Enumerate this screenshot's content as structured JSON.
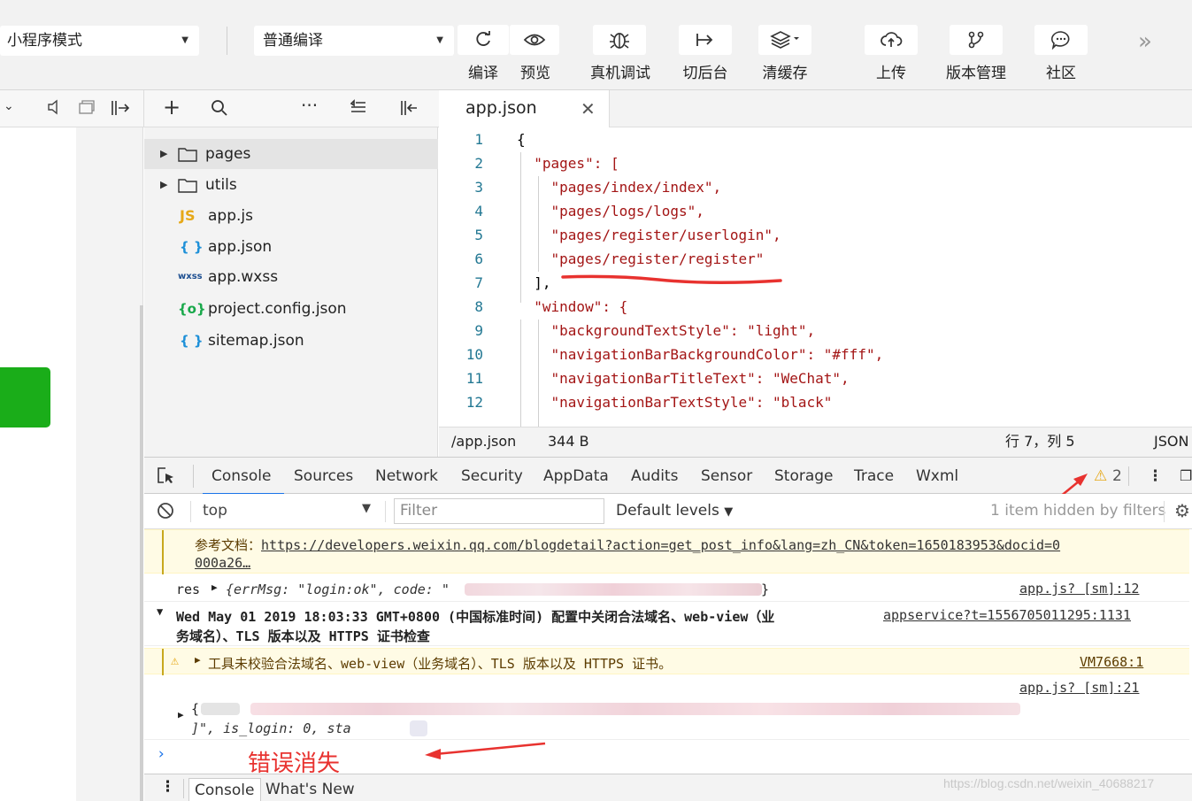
{
  "toolbar": {
    "mode_select": "小程序模式",
    "compile_select": "普通编译",
    "buttons": {
      "compile": "编译",
      "preview": "预览",
      "debug": "真机调试",
      "background": "切后台",
      "clear_cache": "清缓存",
      "upload": "上传",
      "version": "版本管理",
      "community": "社区"
    }
  },
  "file_tree": {
    "items": [
      {
        "name": "pages",
        "icon": "folder-icon"
      },
      {
        "name": "utils",
        "icon": "folder-icon"
      },
      {
        "name": "app.js",
        "icon": "JS"
      },
      {
        "name": "app.json",
        "icon": "{ }"
      },
      {
        "name": "app.wxss",
        "icon": "wxss"
      },
      {
        "name": "project.config.json",
        "icon": "{o}"
      },
      {
        "name": "sitemap.json",
        "icon": "{ }"
      }
    ]
  },
  "editor": {
    "tab_name": "app.json",
    "line_numbers": [
      "1",
      "2",
      "3",
      "4",
      "5",
      "6",
      "7",
      "8",
      "9",
      "10",
      "11",
      "12"
    ],
    "lines": [
      "{",
      "  \"pages\": [",
      "    \"pages/index/index\",",
      "    \"pages/logs/logs\",",
      "    \"pages/register/userlogin\",",
      "    \"pages/register/register\"",
      "  ],",
      "  \"window\": {",
      "    \"backgroundTextStyle\": \"light\",",
      "    \"navigationBarBackgroundColor\": \"#fff\",",
      "    \"navigationBarTitleText\": \"WeChat\",",
      "    \"navigationBarTextStyle\": \"black\""
    ]
  },
  "statusbar": {
    "path": "/app.json",
    "size": "344 B",
    "position": "行 7，列 5",
    "language": "JSON"
  },
  "devtools": {
    "tabs": [
      "Console",
      "Sources",
      "Network",
      "Security",
      "AppData",
      "Audits",
      "Sensor",
      "Storage",
      "Trace",
      "Wxml"
    ],
    "warning_count": "2",
    "context": "top",
    "filter_placeholder": "Filter",
    "levels": "Default levels",
    "hidden_msg": "1 item hidden by filters"
  },
  "console": {
    "doc_label": "参考文档：",
    "doc_link": "https://developers.weixin.qq.com/blogdetail?action=get_post_info&lang=zh_CN&token=1650183953&docid=0",
    "doc_link_cont": "000a26…",
    "res_prefix": "res",
    "res_object": "{errMsg: \"login:ok\", code: \"",
    "res_close": "}",
    "res_source": "app.js? [sm]:12",
    "date_line": "Wed May 01 2019 18:03:33 GMT+0800 (中国标准时间) 配置中关闭合法域名、web-view（业",
    "date_line2": "务域名）、TLS 版本以及 HTTPS 证书检查",
    "date_source": "appservice?t=1556705011295:1131",
    "warn_text": "工具未校验合法域名、web-view（业务域名）、TLS 版本以及 HTTPS 证书。",
    "warn_source": "VM7668:1",
    "obj_source": "app.js? [sm]:21",
    "obj_line2": "]\", is_login: 0, sta",
    "annotation": "错误消失"
  },
  "drawer": {
    "tabs": [
      "Console",
      "What's New"
    ]
  },
  "watermark": "https://blog.csdn.net/weixin_40688217"
}
